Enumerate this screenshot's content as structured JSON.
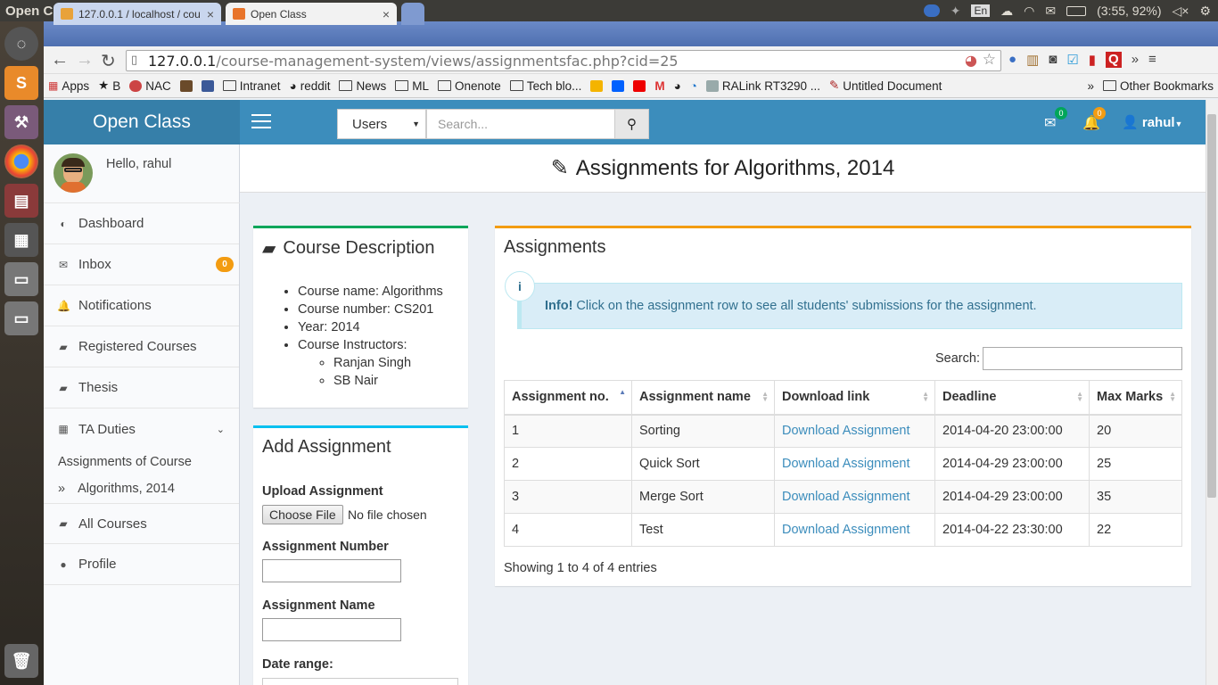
{
  "os": {
    "window_title": "Open Class - Google Chrome",
    "keyboard": "En",
    "battery_time": "(3:55, 92%)"
  },
  "browser": {
    "tabs": [
      {
        "label": "127.0.0.1 / localhost / cou"
      },
      {
        "label": "Open Class"
      }
    ],
    "url_host": "127.0.0.1",
    "url_path": "/course-management-system/views/assignmentsfac.php?cid=25",
    "bookmarks": [
      "Apps",
      "B",
      "NAC",
      "Intranet",
      "reddit",
      "News",
      "ML",
      "Onenote",
      "Tech blo...",
      "RALink RT3290 ...",
      "Untitled Document"
    ],
    "other_bookmarks": "Other Bookmarks",
    "overflow": "»"
  },
  "app": {
    "brand": "Open Class",
    "search_scope": "Users",
    "search_placeholder": "Search...",
    "mail_count": "0",
    "notif_count": "0",
    "username": "rahul"
  },
  "sidebar": {
    "greeting": "Hello, rahul",
    "items": [
      {
        "label": "Dashboard",
        "icon": "dashboard-icon"
      },
      {
        "label": "Inbox",
        "icon": "envelope-icon",
        "badge": "0"
      },
      {
        "label": "Notifications",
        "icon": "bell-icon"
      },
      {
        "label": "Registered Courses",
        "icon": "book-icon"
      },
      {
        "label": "Thesis",
        "icon": "book-icon"
      },
      {
        "label": "TA Duties",
        "icon": "table-icon"
      }
    ],
    "ta_sub_heading": "Assignments of Course",
    "ta_sub_item": "Algorithms, 2014",
    "ta_sub_marker": "»",
    "bottom_items": [
      {
        "label": "All Courses",
        "icon": "book-icon"
      },
      {
        "label": "Profile",
        "icon": "user-icon"
      }
    ]
  },
  "page": {
    "title": "Assignments for Algorithms, 2014"
  },
  "course_description": {
    "title": "Course Description",
    "name": "Course name: Algorithms",
    "number": "Course number: CS201",
    "year": "Year: 2014",
    "instructors_label": "Course Instructors:",
    "instructors": [
      "Ranjan Singh",
      "SB Nair"
    ]
  },
  "add_assignment": {
    "title": "Add Assignment",
    "upload_label": "Upload Assignment",
    "choose_file": "Choose File",
    "no_file": "No file chosen",
    "number_label": "Assignment Number",
    "name_label": "Assignment Name",
    "date_label": "Date range:"
  },
  "assignments": {
    "title": "Assignments",
    "info_strong": "Info!",
    "info_text": " Click on the assignment row to see all students' submissions for the assignment.",
    "info_icon": "i",
    "search_label": "Search:",
    "columns": [
      "Assignment no.",
      "Assignment name",
      "Download link",
      "Deadline",
      "Max Marks"
    ],
    "rows": [
      {
        "no": "1",
        "name": "Sorting",
        "link": "Download Assignment",
        "deadline": "2014-04-20 23:00:00",
        "marks": "20"
      },
      {
        "no": "2",
        "name": "Quick Sort",
        "link": "Download Assignment",
        "deadline": "2014-04-29 23:00:00",
        "marks": "25"
      },
      {
        "no": "3",
        "name": "Merge Sort",
        "link": "Download Assignment",
        "deadline": "2014-04-29 23:00:00",
        "marks": "35"
      },
      {
        "no": "4",
        "name": "Test",
        "link": "Download Assignment",
        "deadline": "2014-04-22 23:30:00",
        "marks": "22"
      }
    ],
    "footer": "Showing 1 to 4 of 4 entries"
  },
  "colors": {
    "header": "#3c8dbc",
    "header_dark": "#367fa9",
    "accent_green": "#00a65a",
    "accent_orange": "#f39c12"
  }
}
